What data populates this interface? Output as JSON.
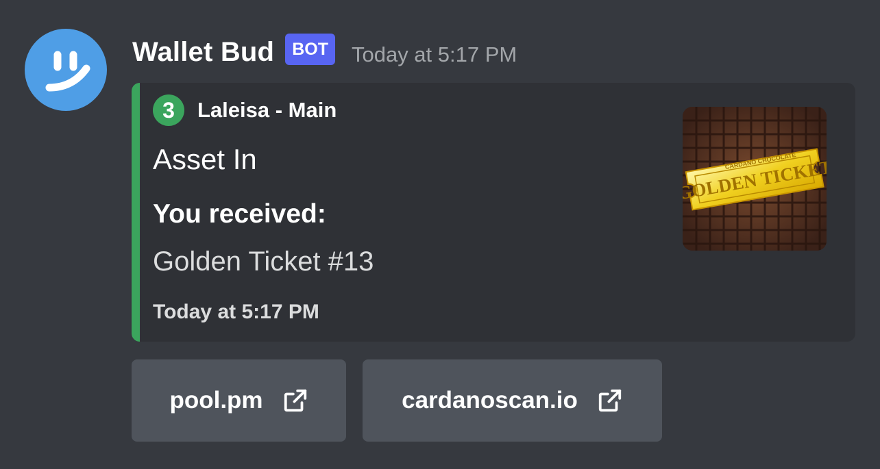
{
  "message": {
    "username": "Wallet Bud",
    "bot_badge": "BOT",
    "timestamp": "Today at 5:17 PM",
    "avatar_icon": "smiley-icon"
  },
  "embed": {
    "accent_color": "#3ba55d",
    "author_icon_text": "3",
    "author_name": "Laleisa - Main",
    "title": "Asset In",
    "field": {
      "name": "You received:",
      "value": "Golden Ticket #13"
    },
    "footer": "Today at 5:17 PM",
    "thumbnail": {
      "description_icon": "golden-ticket-image",
      "ticket_brand": "CARDANO CHOCOLATE",
      "ticket_text": "GOLDEN TICKET"
    }
  },
  "buttons": [
    {
      "label": "pool.pm",
      "icon": "external-link-icon"
    },
    {
      "label": "cardanoscan.io",
      "icon": "external-link-icon"
    }
  ],
  "colors": {
    "background": "#36393f",
    "embed_bg": "#2f3136",
    "bot_badge": "#5865f2",
    "button_bg": "#4f545c"
  }
}
